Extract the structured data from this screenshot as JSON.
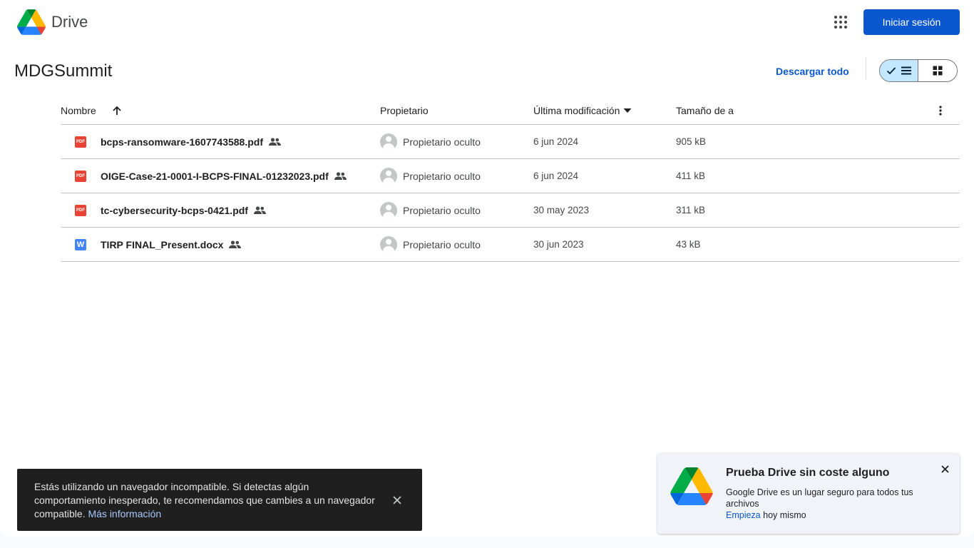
{
  "header": {
    "app_name": "Drive",
    "signin_label": "Iniciar sesión"
  },
  "folder": {
    "title": "MDGSummit",
    "download_all_label": "Descargar todo"
  },
  "table": {
    "columns": {
      "name": "Nombre",
      "owner": "Propietario",
      "modified": "Última modificación",
      "size": "Tamaño de a"
    },
    "rows": [
      {
        "type": "pdf",
        "type_label": "PDF",
        "name": "bcps-ransomware-1607743588.pdf",
        "owner": "Propietario oculto",
        "modified": "6 jun 2024",
        "size": "905 kB"
      },
      {
        "type": "pdf",
        "type_label": "PDF",
        "name": "OIGE-Case-21-0001-I-BCPS-FINAL-01232023.pdf",
        "owner": "Propietario oculto",
        "modified": "6 jun 2024",
        "size": "411 kB"
      },
      {
        "type": "pdf",
        "type_label": "PDF",
        "name": "tc-cybersecurity-bcps-0421.pdf",
        "owner": "Propietario oculto",
        "modified": "30 may 2023",
        "size": "311 kB"
      },
      {
        "type": "doc",
        "type_label": "W",
        "name": "TIRP FINAL_Present.docx",
        "owner": "Propietario oculto",
        "modified": "30 jun 2023",
        "size": "43 kB"
      }
    ]
  },
  "snackbar": {
    "message": "Estás utilizando un navegador incompatible. Si detectas algún comportamiento inesperado, te recomendamos que cambies a un navegador compatible.",
    "link_label": "Más información"
  },
  "promo": {
    "title": "Prueba Drive sin coste alguno",
    "body": "Google Drive es un lugar seguro para todos tus archivos",
    "link_label": "Empieza",
    "suffix": "hoy mismo"
  },
  "colors": {
    "primary": "#0b57d0",
    "pdf_red": "#ea4335",
    "doc_blue": "#4285f4",
    "selected_toggle": "#c2e7ff"
  },
  "icons": {
    "apps": "apps-grid-icon",
    "sort": "arrow-up-icon",
    "sort_desc": "caret-down-icon",
    "more": "more-vert-icon",
    "shared": "people-icon",
    "list_view": "list-view-icon",
    "grid_view": "grid-view-icon",
    "close": "close-icon"
  }
}
